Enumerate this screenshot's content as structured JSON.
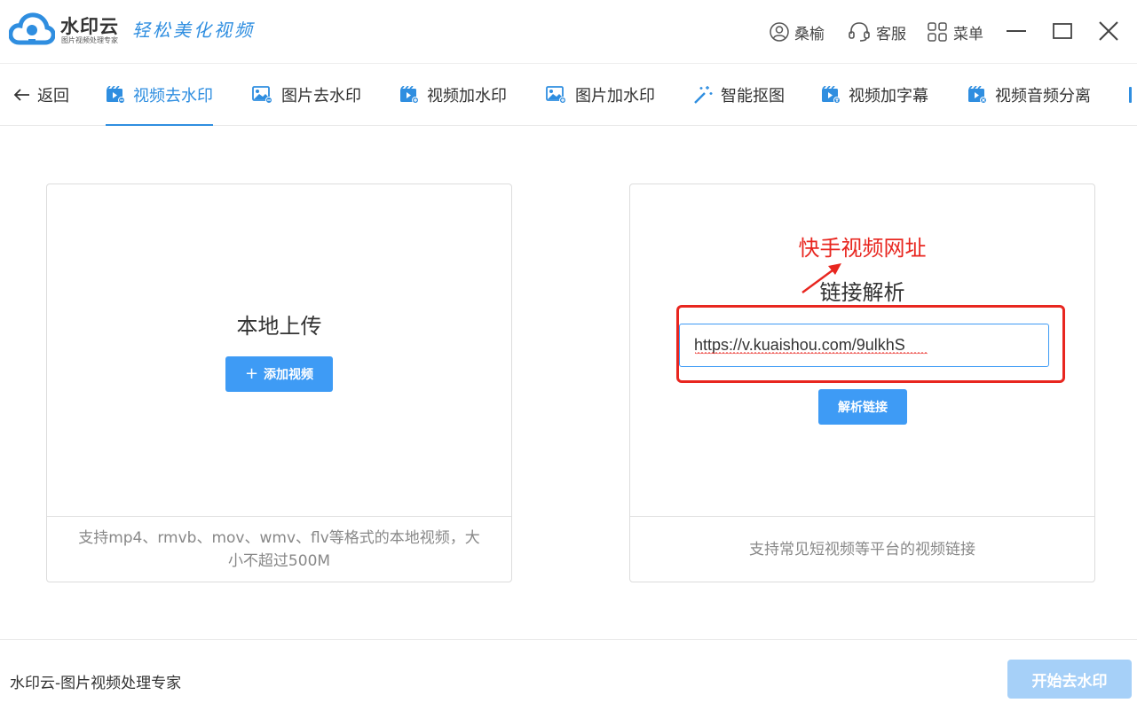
{
  "app": {
    "name": "水印云",
    "subtitle": "图片视频处理专家",
    "slogan": "轻松美化视频"
  },
  "header": {
    "user_label": "桑榆",
    "service_label": "客服",
    "menu_label": "菜单"
  },
  "tabs": {
    "back_label": "返回",
    "items": [
      {
        "label": "视频去水印",
        "icon": "video-remove-watermark-icon",
        "active": true
      },
      {
        "label": "图片去水印",
        "icon": "image-remove-watermark-icon"
      },
      {
        "label": "视频加水印",
        "icon": "video-add-watermark-icon"
      },
      {
        "label": "图片加水印",
        "icon": "image-add-watermark-icon"
      },
      {
        "label": "智能抠图",
        "icon": "magic-wand-icon"
      },
      {
        "label": "视频加字幕",
        "icon": "video-subtitle-icon"
      },
      {
        "label": "视频音频分离",
        "icon": "video-audio-split-icon"
      }
    ]
  },
  "local_upload": {
    "title": "本地上传",
    "button_label": "添加视频",
    "footer": "支持mp4、rmvb、mov、wmv、flv等格式的本地视频，大小不超过500M"
  },
  "link_parse": {
    "annotation": "快手视频网址",
    "title": "链接解析",
    "url_value": "https://v.kuaishou.com/9ulkhS",
    "button_label": "解析链接",
    "footer": "支持常见短视频等平台的视频链接"
  },
  "footer": {
    "brand_text": "水印云-图片视频处理专家",
    "start_label": "开始去水印"
  },
  "colors": {
    "accent": "#2f8ee0",
    "button": "#3e9bf5",
    "button_disabled": "#a6d0f8",
    "annotation": "#e8261f"
  }
}
